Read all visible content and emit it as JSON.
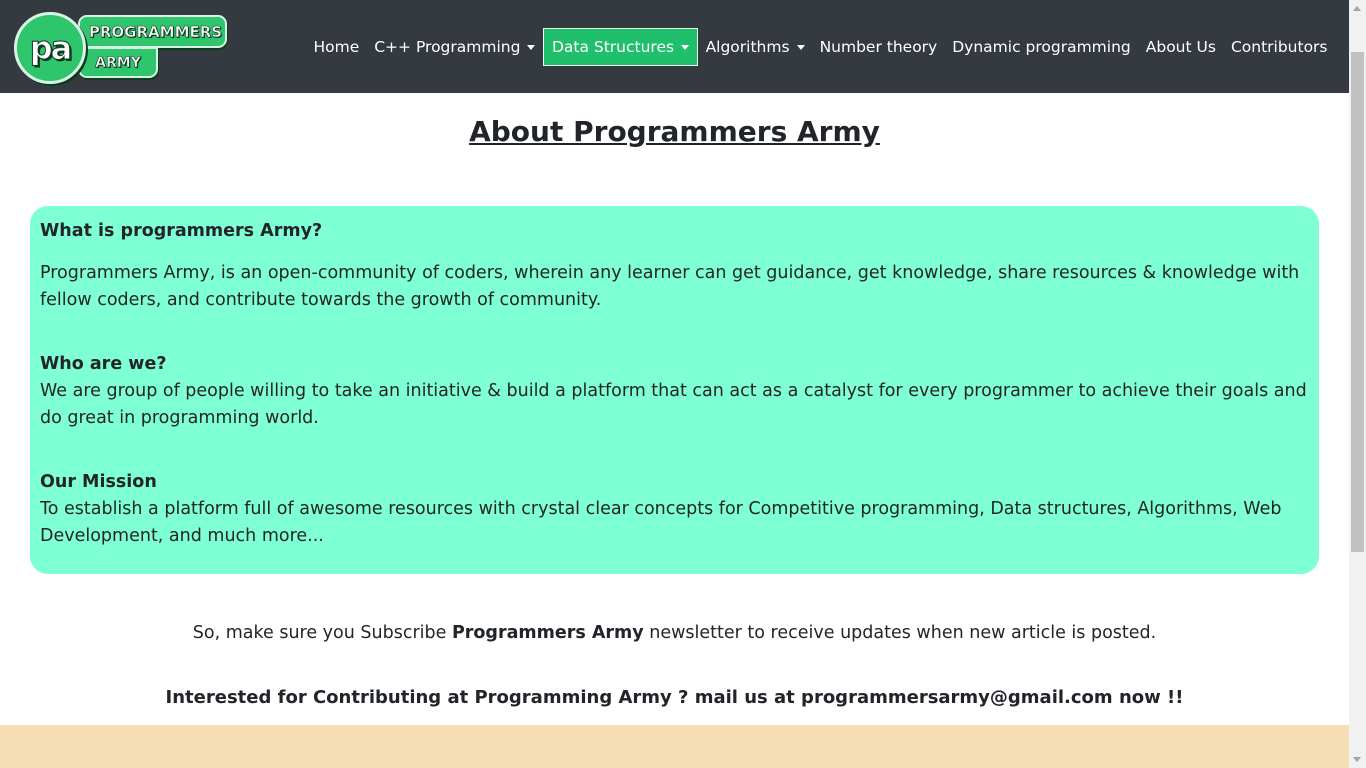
{
  "logo": {
    "monogram": "pa",
    "line1": "PROGRAMMERS",
    "line2": "ARMY"
  },
  "nav": {
    "items": [
      {
        "label": "Home",
        "dropdown": false,
        "active": false
      },
      {
        "label": "C++ Programming",
        "dropdown": true,
        "active": false
      },
      {
        "label": "Data Structures",
        "dropdown": true,
        "active": true
      },
      {
        "label": "Algorithms",
        "dropdown": true,
        "active": false
      },
      {
        "label": "Number theory",
        "dropdown": false,
        "active": false
      },
      {
        "label": "Dynamic programming",
        "dropdown": false,
        "active": false
      },
      {
        "label": "About Us",
        "dropdown": false,
        "active": false
      },
      {
        "label": "Contributors",
        "dropdown": false,
        "active": false
      }
    ]
  },
  "main": {
    "title": "About Programmers Army",
    "sections": [
      {
        "heading": "What is programmers Army?",
        "body": "Programmers Army, is an open-community of coders, wherein any learner can get guidance, get knowledge, share resources & knowledge with fellow coders, and contribute towards the growth of community."
      },
      {
        "heading": "Who are we?",
        "body": "We are group of people willing to take an initiative & build a platform that can act as a catalyst for every programmer to achieve their goals and do great in programming world."
      },
      {
        "heading": "Our Mission",
        "body": "To establish a platform full of awesome resources with crystal clear concepts for Competitive programming, Data structures, Algorithms, Web Development, and much more..."
      }
    ],
    "subscribe": {
      "before": "So, make sure you Subscribe ",
      "brand": "Programmers Army",
      "after": " newsletter to receive updates when new article is posted."
    },
    "contribute": "Interested for Contributing at Programming Army ? mail us at programmersarmy@gmail.com now !!"
  },
  "colors": {
    "navbar": "#343a40",
    "active_nav": "#1fbf6b",
    "card": "#7fffd4",
    "footer": "#f5deb3"
  }
}
